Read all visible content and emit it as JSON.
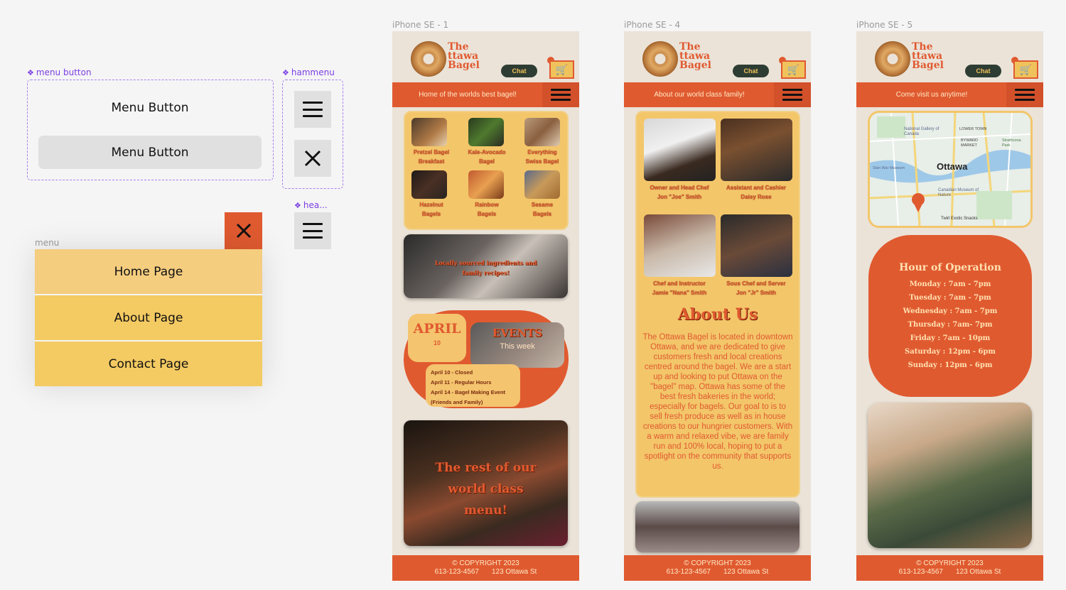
{
  "components": {
    "menu_button": {
      "label": "menu button",
      "variant1": "Menu Button",
      "variant2": "Menu Button"
    },
    "hammenu": {
      "label": "hammenu"
    },
    "header_icon": {
      "label": "hea..."
    },
    "menu": {
      "label": "menu",
      "items": [
        "Home Page",
        "About Page",
        "Contact Page"
      ]
    }
  },
  "colors": {
    "accent_orange": "#e05a30",
    "yellow": "#f3c66a",
    "cream": "#ebe3d8",
    "component_purple": "#7b3fe4"
  },
  "phones": [
    {
      "frame_label": "iPhone SE - 1",
      "logo": [
        "The",
        "ttawa",
        "Bagel"
      ],
      "chat": "Chat",
      "nav_text": "Home of the worlds best bagel!",
      "bagels": [
        [
          "Pretzel Bagel",
          "Breakfast"
        ],
        [
          "Kale-Avocado",
          "Bagel"
        ],
        [
          "Everything",
          "Swiss Bagel"
        ],
        [
          "Hazelnut",
          "Bagels"
        ],
        [
          "Rainbow",
          "Bagels"
        ],
        [
          "Sesame",
          "Bagels"
        ]
      ],
      "promo1": [
        "Locally sourced ingredients and",
        "family recipes!"
      ],
      "april": "APRIL",
      "april_day": "10",
      "events_title": "EVENTS",
      "events_sub": "This week",
      "events": [
        "April 10 - Closed",
        "April 11 - Regular Hours",
        "April 14 - Bagel Making Event",
        "(Friends and Family)"
      ],
      "promo2": [
        "The rest of our",
        "world class",
        "menu!"
      ],
      "copyright": "© COPYRIGHT 2023",
      "phone": "613-123-4567",
      "address": "123 Ottawa St"
    },
    {
      "frame_label": "iPhone SE - 4",
      "logo": [
        "The",
        "ttawa",
        "Bagel"
      ],
      "chat": "Chat",
      "nav_text": "About our world class family!",
      "staff": [
        [
          "Owner and Head Chef",
          "Jon \"Joe\" Smith"
        ],
        [
          "Assistant and Cashier",
          "Daisy Rose"
        ],
        [
          "Chef and Instructor",
          "Jamie \"Nana\" Smith"
        ],
        [
          "Sous Chef and Server",
          "Jon \"Jr\" Smith"
        ]
      ],
      "about_title": "About Us",
      "about_text": "The Ottawa Bagel is located in downtown Ottawa, and we are dedicated to give customers fresh and local creations centred around the bagel. We are a start up and looking to put Ottawa on the \"bagel\" map. Ottawa has some of the best fresh bakeries in the world; especially for bagels. Our goal to is to sell fresh produce as well as in house creations to our hungrier customers. With a warm and relaxed vibe, we are family run and 100% local, hoping to put a spotlight on the community that supports us.",
      "copyright": "© COPYRIGHT 2023",
      "phone": "613-123-4567",
      "address": "123 Ottawa St"
    },
    {
      "frame_label": "iPhone SE - 5",
      "logo": [
        "The",
        "ttawa",
        "Bagel"
      ],
      "chat": "Chat",
      "nav_text": "Come visit us anytime!",
      "map": {
        "city": "Ottawa",
        "places": [
          "National Gallery of Canada",
          "LOWER TOWN",
          "BYWARD MARKET",
          "Strathcona Park",
          "Slan War Museum",
          "Canadian Museum of Nature",
          "Twirl Exotic Snacks"
        ]
      },
      "hours_title": "Hour of Operation",
      "hours": [
        "Monday : 7am - 7pm",
        "Tuesday : 7am - 7pm",
        "Wednesday : 7am - 7pm",
        "Thursday : 7am- 7pm",
        "Friday : 7am - 10pm",
        "Saturday : 12pm - 6pm",
        "Sunday : 12pm - 6pm"
      ],
      "copyright": "© COPYRIGHT 2023",
      "phone": "613-123-4567",
      "address": "123 Ottawa St"
    }
  ]
}
